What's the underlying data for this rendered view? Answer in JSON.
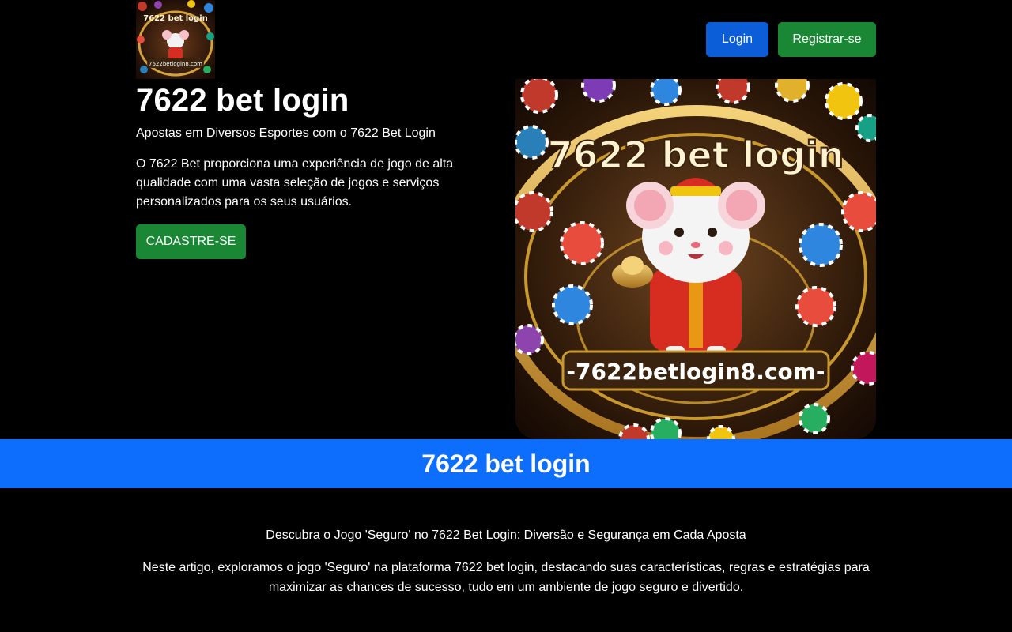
{
  "header": {
    "logo_alt": "7622 bet login",
    "logo_text": "7622 bet login",
    "logo_url_text": "7622betlogin8.com",
    "login_label": "Login",
    "register_label": "Registrar-se"
  },
  "hero": {
    "title": "7622 bet login",
    "subtitle": "Apostas em Diversos Esportes com o 7622 Bet Login",
    "text": "O 7622 Bet proporciona uma experiência de jogo de alta qualidade com uma vasta seleção de jogos e serviços personalizados para os seus usuários.",
    "cta_label": "CADASTRE-SE",
    "image_text": "7622 bet login",
    "image_url_text": "-7622betlogin8.com-"
  },
  "band": {
    "title": "7622 bet login"
  },
  "article": {
    "heading": "Descubra o Jogo 'Seguro' no 7622 Bet Login: Diversão e Segurança em Cada Aposta",
    "text": "Neste artigo, exploramos o jogo 'Seguro' na plataforma 7622 bet login, destacando suas características, regras e estratégias para maximizar as chances de sucesso, tudo em um ambiente de jogo seguro e divertido."
  },
  "colors": {
    "background": "#000000",
    "login_button": "#0b5ed7",
    "register_button": "#198734",
    "band": "#0d6efd"
  }
}
